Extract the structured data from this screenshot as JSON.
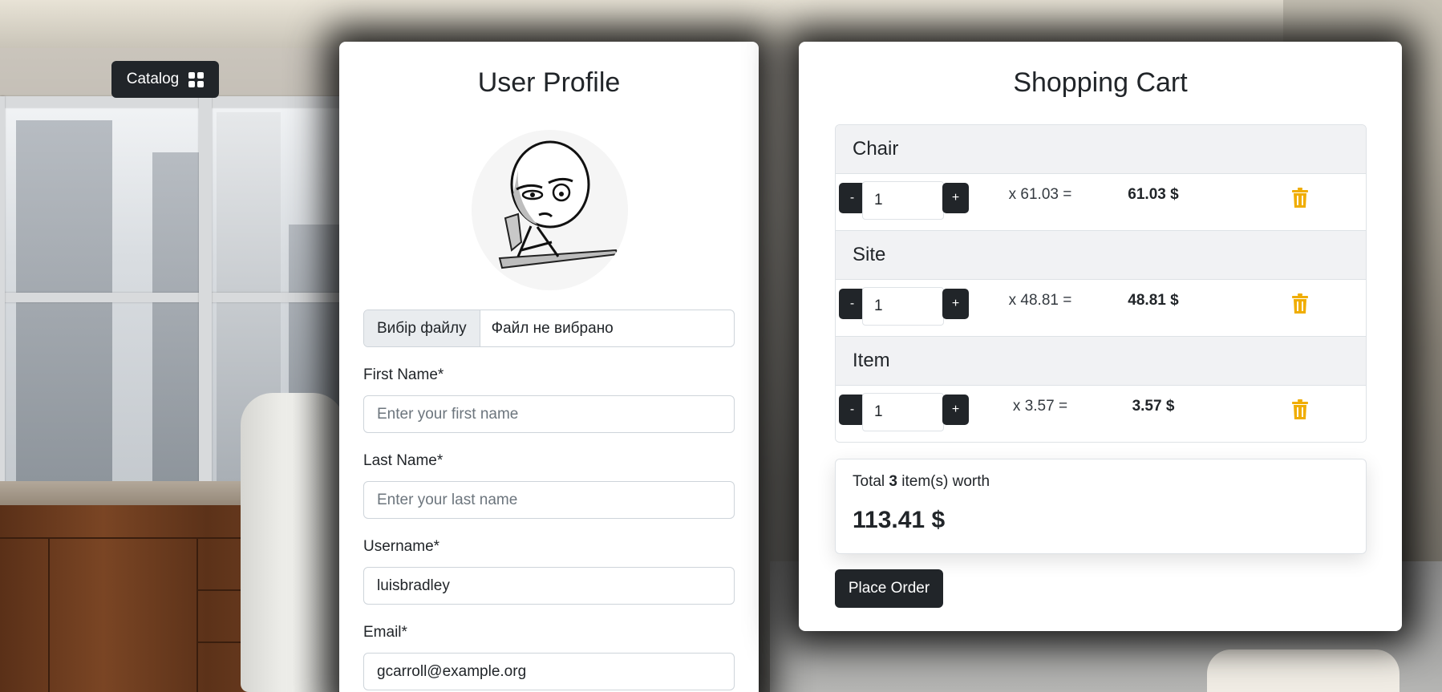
{
  "catalog_button": {
    "label": "Catalog",
    "icon": "grid-icon"
  },
  "profile": {
    "title": "User Profile",
    "avatar_icon": "avatar-image",
    "file_input": {
      "button_label": "Вибір файлу",
      "status": "Файл не вибрано"
    },
    "fields": {
      "first_name": {
        "label": "First Name*",
        "value": "",
        "placeholder": "Enter your first name"
      },
      "last_name": {
        "label": "Last Name*",
        "value": "",
        "placeholder": "Enter your last name"
      },
      "username": {
        "label": "Username*",
        "value": "luisbradley",
        "placeholder": ""
      },
      "email": {
        "label": "Email*",
        "value": "gcarroll@example.org",
        "placeholder": ""
      }
    }
  },
  "cart": {
    "title": "Shopping Cart",
    "items": [
      {
        "name": "Chair",
        "qty": "1",
        "price_text": "x 61.03 =",
        "total": "61.03 $",
        "minus": "-",
        "plus": "+"
      },
      {
        "name": "Site",
        "qty": "1",
        "price_text": "x 48.81 =",
        "total": "48.81 $",
        "minus": "-",
        "plus": "+"
      },
      {
        "name": "Item",
        "qty": "1",
        "price_text": "x 3.57 =",
        "total": "3.57 $",
        "minus": "-",
        "plus": "+"
      }
    ],
    "summary": {
      "prefix": "Total",
      "count": "3",
      "suffix": "item(s) worth",
      "total": "113.41 $"
    },
    "place_order_label": "Place Order",
    "trash_color": "#f0ad00"
  }
}
